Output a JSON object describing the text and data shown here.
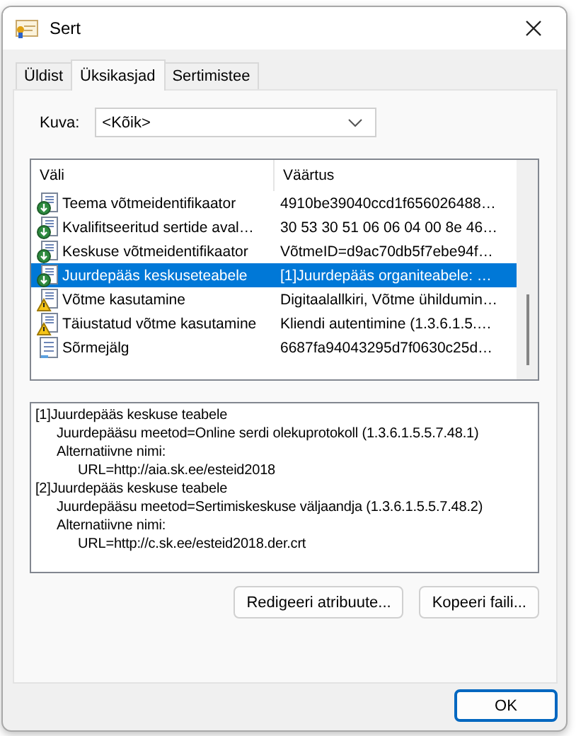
{
  "window": {
    "title": "Sert"
  },
  "tabs": [
    {
      "label": "Üldist",
      "selected": false
    },
    {
      "label": "Üksikasjad",
      "selected": true
    },
    {
      "label": "Sertimistee",
      "selected": false
    }
  ],
  "show": {
    "label": "Kuva:",
    "value": "<Kõik>"
  },
  "table": {
    "columns": [
      "Väli",
      "Väärtus"
    ],
    "rows": [
      {
        "kind": "extension",
        "field": "Teema võtmeidentifikaator",
        "value": "4910be39040ccd1f656026488…",
        "selected": false
      },
      {
        "kind": "extension",
        "field": "Kvalifitseeritud sertide aval…",
        "value": "30 53 30 51 06 06 04 00 8e 46…",
        "selected": false
      },
      {
        "kind": "extension",
        "field": "Keskuse võtmeidentifikaator",
        "value": "VõtmeID=d9ac70db5f7ebe94f…",
        "selected": false
      },
      {
        "kind": "extension",
        "field": "Juurdepääs keskuseteabele",
        "value": "[1]Juurdepääs organiteabele: …",
        "selected": true
      },
      {
        "kind": "critical",
        "field": "Võtme kasutamine",
        "value": "Digitaalallkiri, Võtme ühildumin…",
        "selected": false
      },
      {
        "kind": "critical",
        "field": "Täiustatud võtme kasutamine",
        "value": "Kliendi autentimine (1.3.6.1.5.…",
        "selected": false
      },
      {
        "kind": "property",
        "field": "Sõrmejälg",
        "value": "6687fa94043295d7f0630c25d…",
        "selected": false
      }
    ]
  },
  "details": [
    {
      "text": "[1]Juurdepääs keskuse teabele",
      "children": [
        {
          "text": "Juurdepääsu meetod=Online serdi olekuprotokoll (1.3.6.1.5.5.7.48.1)"
        },
        {
          "text": "Alternatiivne nimi:",
          "children": [
            {
              "text": "URL=http://aia.sk.ee/esteid2018"
            }
          ]
        }
      ]
    },
    {
      "text": "[2]Juurdepääs keskuse teabele",
      "children": [
        {
          "text": "Juurdepääsu meetod=Sertimiskeskuse väljaandja (1.3.6.1.5.5.7.48.2)"
        },
        {
          "text": "Alternatiivne nimi:",
          "children": [
            {
              "text": "URL=http://c.sk.ee/esteid2018.der.crt"
            }
          ]
        }
      ]
    }
  ],
  "buttons": [
    "Redigeeri atribuute...",
    "Kopeeri faili..."
  ],
  "ok_button": "OK"
}
